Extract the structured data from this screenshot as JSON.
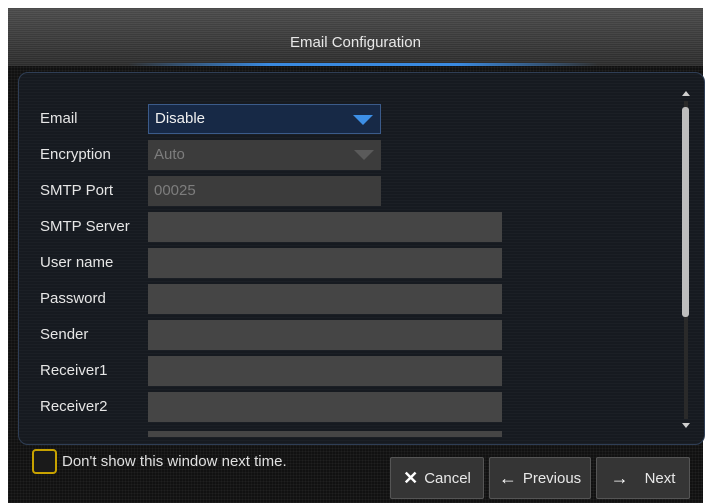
{
  "dialog": {
    "title": "Email Configuration"
  },
  "form": {
    "email": {
      "label": "Email",
      "value": "Disable"
    },
    "encryption": {
      "label": "Encryption",
      "value": "Auto"
    },
    "smtp_port": {
      "label": "SMTP Port",
      "value": "00025"
    },
    "smtp_server": {
      "label": "SMTP Server",
      "value": ""
    },
    "user_name": {
      "label": "User name",
      "value": ""
    },
    "password": {
      "label": "Password",
      "value": ""
    },
    "sender": {
      "label": "Sender",
      "value": ""
    },
    "receiver1": {
      "label": "Receiver1",
      "value": ""
    },
    "receiver2": {
      "label": "Receiver2",
      "value": ""
    }
  },
  "footer": {
    "dont_show_label": "Don't show this window next time.",
    "dont_show_checked": false,
    "cancel_label": "Cancel",
    "previous_label": "Previous",
    "next_label": "Next"
  },
  "colors": {
    "accent": "#3a8ae0",
    "checkbox_border": "#c7a200"
  },
  "icons": {
    "cancel": "close-icon",
    "previous": "arrow-left-icon",
    "next": "arrow-right-icon"
  }
}
